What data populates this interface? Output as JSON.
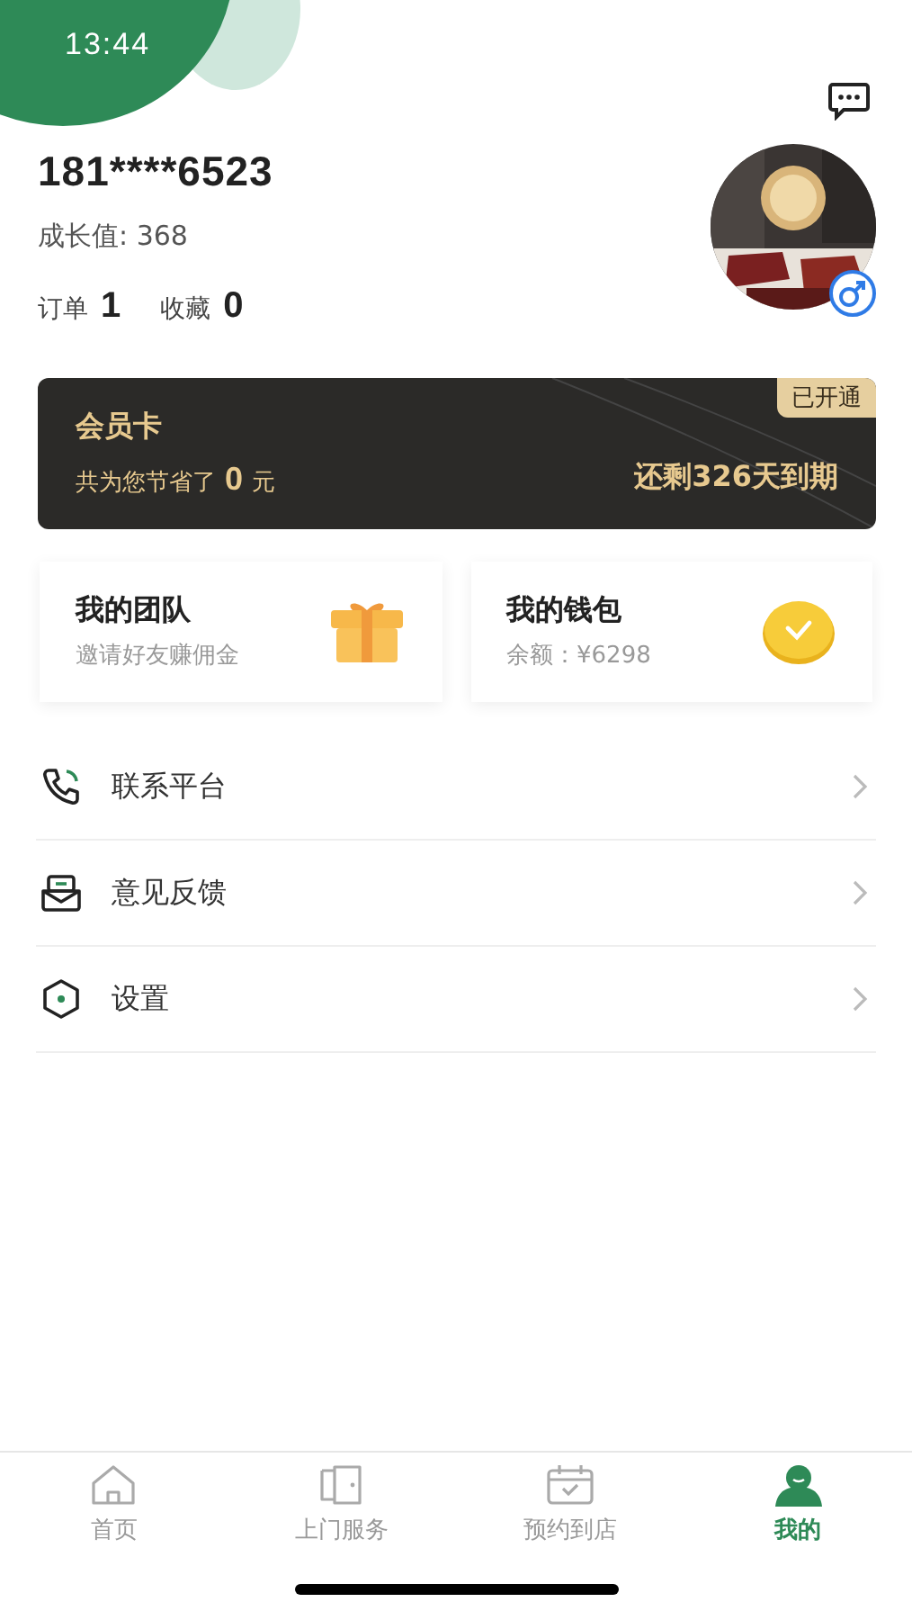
{
  "status_bar": {
    "time": "13:44"
  },
  "profile": {
    "phone": "181****6523",
    "growth": "成长值: 368"
  },
  "stats": [
    {
      "label": "订单",
      "value": "1"
    },
    {
      "label": "收藏",
      "value": "0"
    }
  ],
  "member_card": {
    "title": "会员卡",
    "status": "已开通",
    "savings_prefix": "共为您节省了",
    "savings_amount": "0",
    "savings_unit": "元",
    "expiry": "还剩326天到期"
  },
  "shortcuts": [
    {
      "kind": "gift",
      "title": "我的团队",
      "subtitle": "邀请好友赚佣金"
    },
    {
      "kind": "coin",
      "title": "我的钱包",
      "subtitle": "余额：¥6298"
    }
  ],
  "menu": [
    {
      "kind": "phone",
      "label": "联系平台"
    },
    {
      "kind": "feedback",
      "label": "意见反馈"
    },
    {
      "kind": "settings",
      "label": "设置"
    }
  ],
  "tabbar": [
    {
      "kind": "home",
      "label": "首页",
      "selected": false
    },
    {
      "kind": "door",
      "label": "上门服务",
      "selected": false
    },
    {
      "kind": "calendar",
      "label": "预约到店",
      "selected": false
    },
    {
      "kind": "person",
      "label": "我的",
      "selected": true
    }
  ]
}
